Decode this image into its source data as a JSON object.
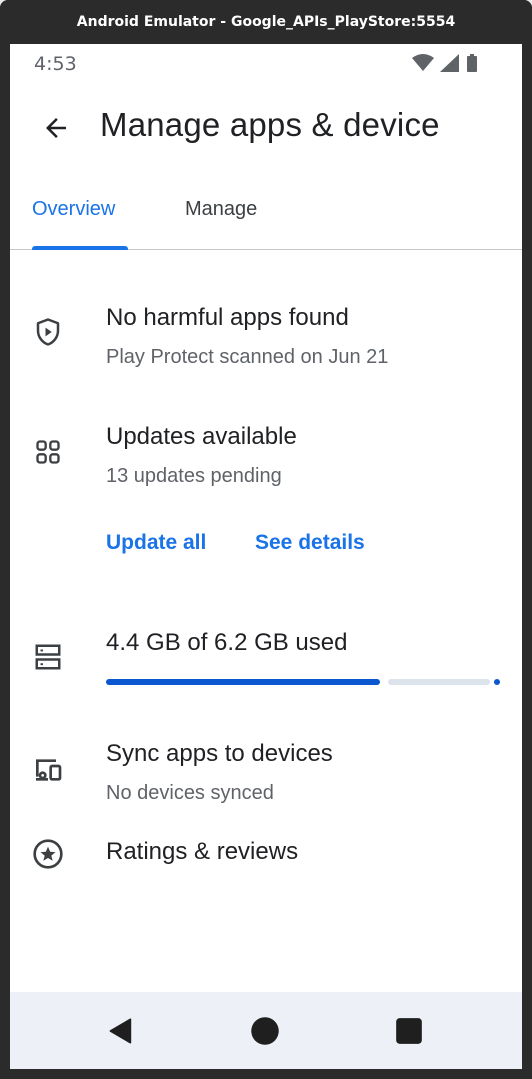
{
  "window": {
    "title": "Android Emulator - Google_APIs_PlayStore:5554"
  },
  "statusbar": {
    "time": "4:53",
    "icons": [
      "wifi-icon",
      "signal-icon",
      "battery-icon"
    ]
  },
  "appbar": {
    "title": "Manage apps & device",
    "back_icon": "arrow-back-icon"
  },
  "tabs": [
    {
      "label": "Overview",
      "active": true
    },
    {
      "label": "Manage",
      "active": false
    }
  ],
  "protect": {
    "icon": "shield-play-icon",
    "title": "No harmful apps found",
    "subtitle": "Play Protect scanned on Jun 21"
  },
  "updates": {
    "icon": "apps-grid-icon",
    "title": "Updates available",
    "subtitle": "13 updates pending",
    "update_all_label": "Update all",
    "see_details_label": "See details"
  },
  "storage": {
    "icon": "storage-icon",
    "title": "4.4 GB of 6.2 GB used",
    "used_gb": 4.4,
    "total_gb": 6.2
  },
  "sync": {
    "icon": "devices-icon",
    "title": "Sync apps to devices",
    "subtitle": "No devices synced"
  },
  "ratings": {
    "icon": "star-circle-icon",
    "title": "Ratings & reviews"
  },
  "navbar": {
    "icons": [
      "back-triangle-icon",
      "home-circle-icon",
      "recents-square-icon"
    ]
  },
  "colors": {
    "accent": "#1a73e8",
    "progress": "#0b57d0",
    "track": "#dde3ea",
    "navbar": "#edf1f7"
  }
}
